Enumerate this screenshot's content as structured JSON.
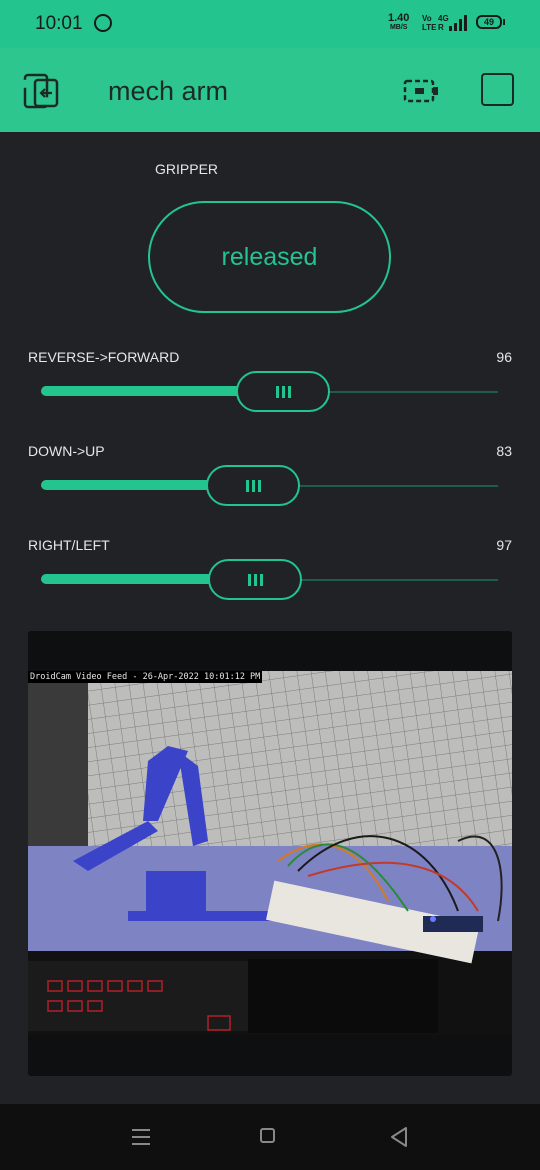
{
  "status_bar": {
    "time": "10:01",
    "net_speed_value": "1.40",
    "net_speed_unit": "MB/S",
    "volte": "Vo LTE",
    "network": "4G R",
    "battery": "49"
  },
  "app_bar": {
    "title": "mech arm",
    "icons": [
      "exit-icon",
      "battery-device-icon",
      "square-icon"
    ]
  },
  "gripper": {
    "label": "GRIPPER",
    "button_state": "released"
  },
  "sliders": [
    {
      "label": "REVERSE->FORWARD",
      "value": "96",
      "fill_fraction": 0.5
    },
    {
      "label": "DOWN->UP",
      "value": "83",
      "fill_fraction": 0.44
    },
    {
      "label": "RIGHT/LEFT",
      "value": "97",
      "fill_fraction": 0.44
    }
  ],
  "video": {
    "overlay_text": "DroidCam Video Feed - 26-Apr-2022 10:01:12 PM"
  },
  "colors": {
    "accent": "#23c48e",
    "background": "#212226",
    "track": "#1d5d4c"
  }
}
